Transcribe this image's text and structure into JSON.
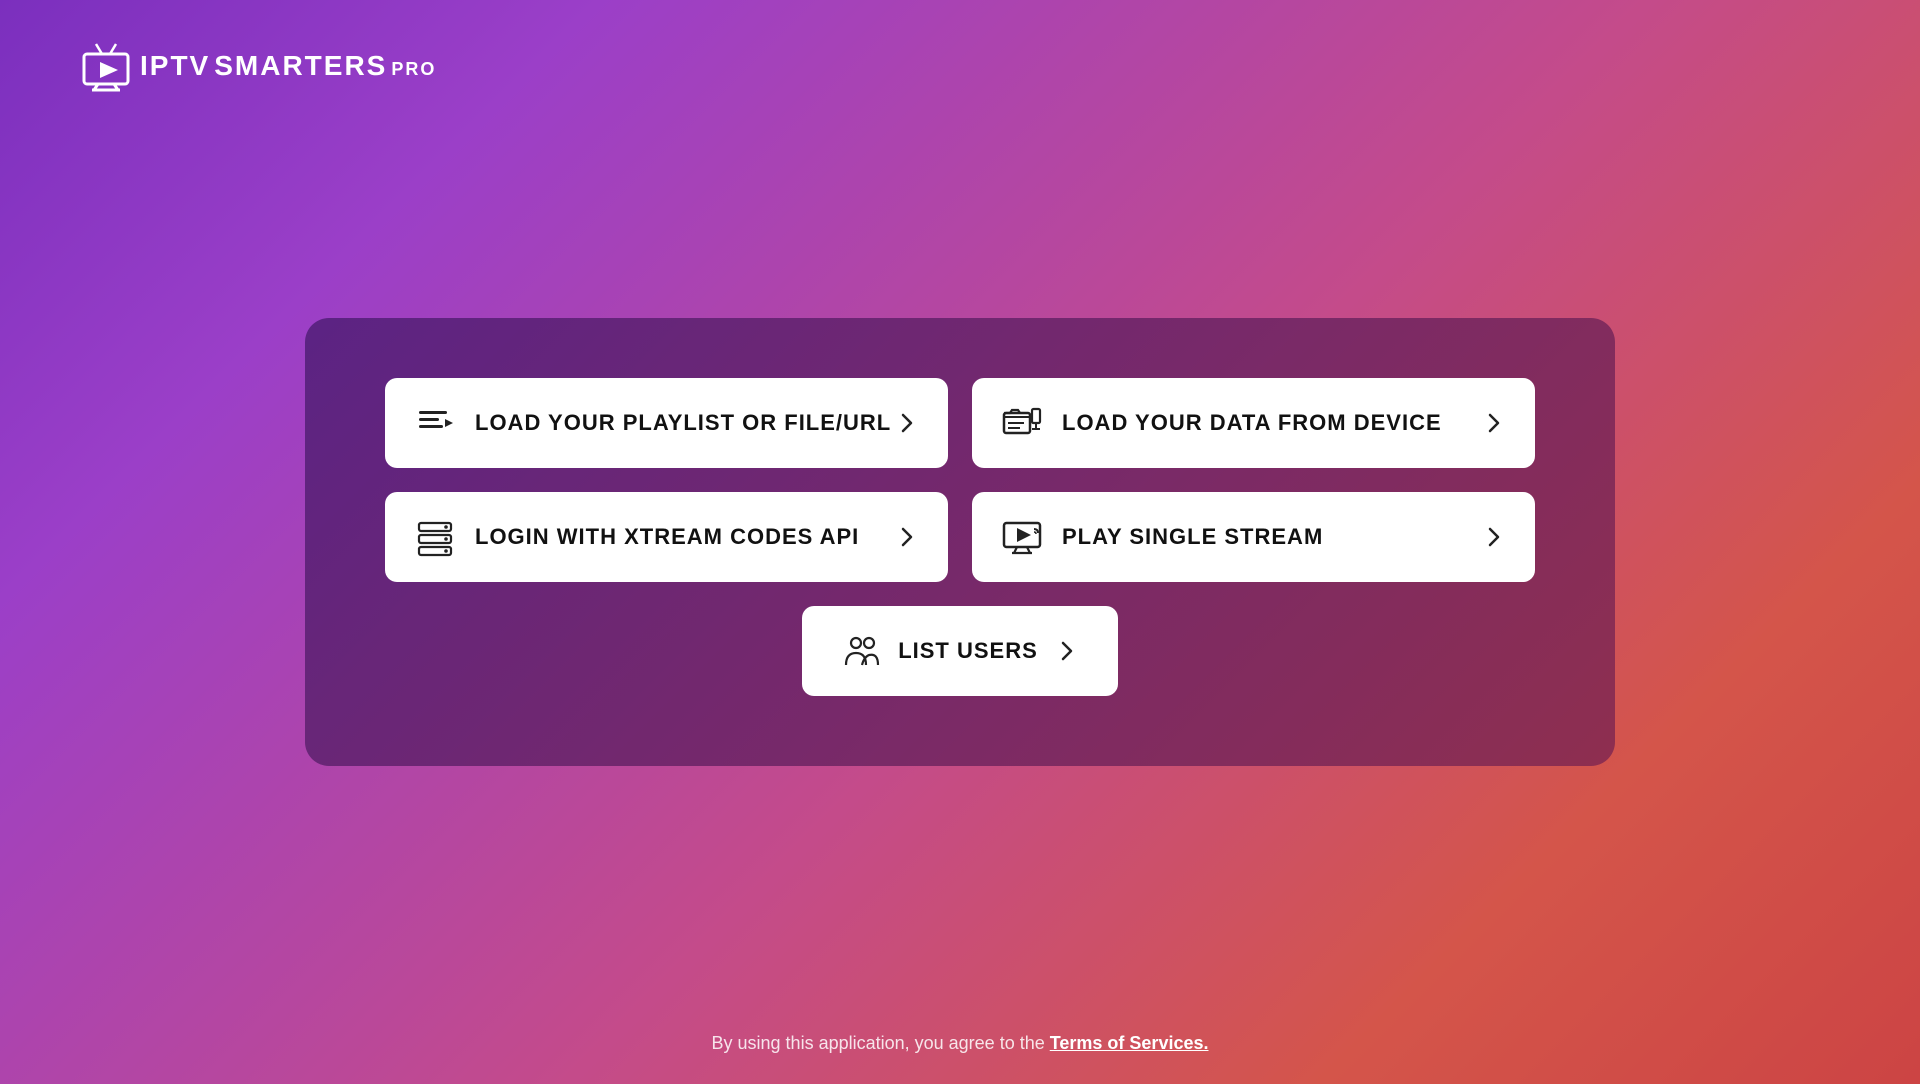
{
  "logo": {
    "iptv": "IPTV",
    "smarters": "SMARTERS",
    "pro": "PRO"
  },
  "buttons": {
    "row1": [
      {
        "id": "load-playlist",
        "label": "LOAD YOUR PLAYLIST OR FILE/URL",
        "icon": "playlist-icon"
      },
      {
        "id": "load-device",
        "label": "LOAD YOUR DATA FROM DEVICE",
        "icon": "device-icon"
      }
    ],
    "row2": [
      {
        "id": "login-xtream",
        "label": "LOGIN WITH XTREAM CODES API",
        "icon": "xtream-icon"
      },
      {
        "id": "play-stream",
        "label": "PLAY SINGLE STREAM",
        "icon": "stream-icon"
      }
    ],
    "center": {
      "id": "list-users",
      "label": "LIST USERS",
      "icon": "users-icon"
    }
  },
  "footer": {
    "text": "By using this application, you agree to the ",
    "link_text": "Terms of Services."
  }
}
